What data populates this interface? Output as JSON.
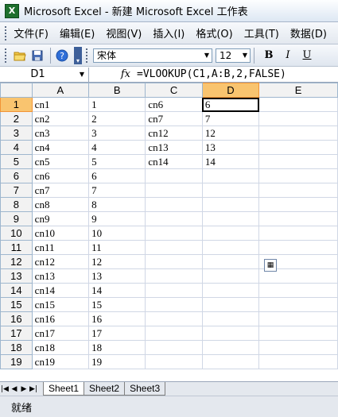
{
  "window": {
    "title": "Microsoft Excel - 新建 Microsoft Excel 工作表"
  },
  "menu": [
    "文件(F)",
    "编辑(E)",
    "视图(V)",
    "插入(I)",
    "格式(O)",
    "工具(T)",
    "数据(D)"
  ],
  "toolbar": {
    "font": "宋体",
    "size": "12",
    "bold": "B",
    "italic": "I",
    "underline": "U"
  },
  "formula_bar": {
    "cell": "D1",
    "fx": "fx",
    "formula": "=VLOOKUP(C1,A:B,2,FALSE)"
  },
  "columns": [
    "A",
    "B",
    "C",
    "D",
    "E"
  ],
  "rows": [
    {
      "n": "1",
      "a": "cn1",
      "b": "1",
      "c": "cn6",
      "d": "6"
    },
    {
      "n": "2",
      "a": "cn2",
      "b": "2",
      "c": "cn7",
      "d": "7"
    },
    {
      "n": "3",
      "a": "cn3",
      "b": "3",
      "c": "cn12",
      "d": "12"
    },
    {
      "n": "4",
      "a": "cn4",
      "b": "4",
      "c": "cn13",
      "d": "13"
    },
    {
      "n": "5",
      "a": "cn5",
      "b": "5",
      "c": "cn14",
      "d": "14"
    },
    {
      "n": "6",
      "a": "cn6",
      "b": "6",
      "c": "",
      "d": ""
    },
    {
      "n": "7",
      "a": "cn7",
      "b": "7",
      "c": "",
      "d": ""
    },
    {
      "n": "8",
      "a": "cn8",
      "b": "8",
      "c": "",
      "d": ""
    },
    {
      "n": "9",
      "a": "cn9",
      "b": "9",
      "c": "",
      "d": ""
    },
    {
      "n": "10",
      "a": "cn10",
      "b": "10",
      "c": "",
      "d": ""
    },
    {
      "n": "11",
      "a": "cn11",
      "b": "11",
      "c": "",
      "d": ""
    },
    {
      "n": "12",
      "a": "cn12",
      "b": "12",
      "c": "",
      "d": ""
    },
    {
      "n": "13",
      "a": "cn13",
      "b": "13",
      "c": "",
      "d": ""
    },
    {
      "n": "14",
      "a": "cn14",
      "b": "14",
      "c": "",
      "d": ""
    },
    {
      "n": "15",
      "a": "cn15",
      "b": "15",
      "c": "",
      "d": ""
    },
    {
      "n": "16",
      "a": "cn16",
      "b": "16",
      "c": "",
      "d": ""
    },
    {
      "n": "17",
      "a": "cn17",
      "b": "17",
      "c": "",
      "d": ""
    },
    {
      "n": "18",
      "a": "cn18",
      "b": "18",
      "c": "",
      "d": ""
    },
    {
      "n": "19",
      "a": "cn19",
      "b": "19",
      "c": "",
      "d": ""
    }
  ],
  "sheets": [
    "Sheet1",
    "Sheet2",
    "Sheet3"
  ],
  "status": "就绪"
}
